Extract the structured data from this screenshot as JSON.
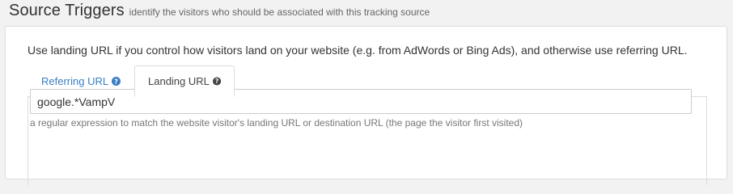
{
  "header": {
    "title": "Source Triggers",
    "subtitle": "identify the visitors who should be associated with this tracking source"
  },
  "panel": {
    "intro": "Use landing URL if you control how visitors land on your website (e.g. from AdWords or Bing Ads), and otherwise use referring URL."
  },
  "tabs": [
    {
      "label": "Referring URL",
      "icon": "question-circle-icon",
      "active": false
    },
    {
      "label": "Landing URL",
      "icon": "question-circle-icon",
      "active": true
    }
  ],
  "landing": {
    "value": "google.*VampV",
    "help": "a regular expression to match the website visitor's landing URL or destination URL (the page the visitor first visited)"
  },
  "colors": {
    "link": "#3a7ec4",
    "background": "#f2f2f2",
    "panel": "#ffffff",
    "border": "#dddddd"
  }
}
